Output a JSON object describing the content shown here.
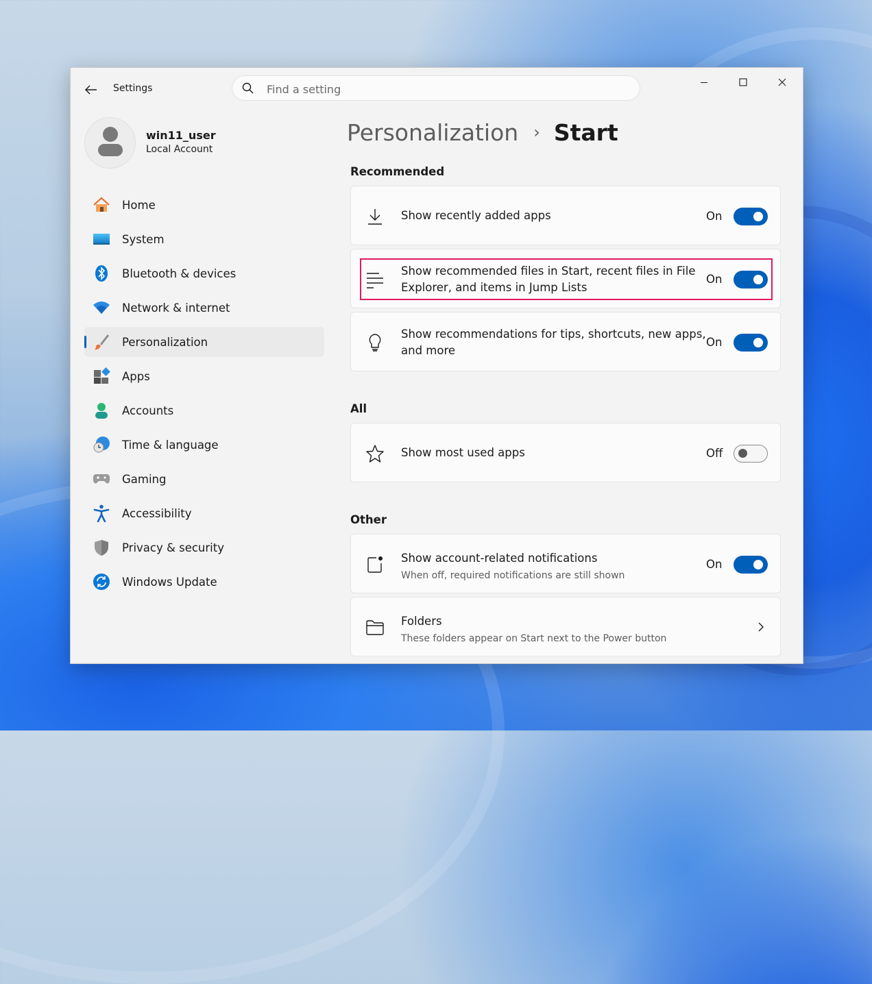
{
  "app": {
    "title": "Settings"
  },
  "search": {
    "placeholder": "Find a setting"
  },
  "user": {
    "name": "win11_user",
    "account_type": "Local Account"
  },
  "nav": [
    {
      "label": "Home",
      "icon": "home-icon"
    },
    {
      "label": "System",
      "icon": "system-icon"
    },
    {
      "label": "Bluetooth & devices",
      "icon": "bluetooth-icon"
    },
    {
      "label": "Network & internet",
      "icon": "wifi-icon"
    },
    {
      "label": "Personalization",
      "icon": "paintbrush-icon",
      "selected": true
    },
    {
      "label": "Apps",
      "icon": "apps-icon"
    },
    {
      "label": "Accounts",
      "icon": "accounts-icon"
    },
    {
      "label": "Time & language",
      "icon": "globe-clock-icon"
    },
    {
      "label": "Gaming",
      "icon": "gamepad-icon"
    },
    {
      "label": "Accessibility",
      "icon": "accessibility-icon"
    },
    {
      "label": "Privacy & security",
      "icon": "shield-icon"
    },
    {
      "label": "Windows Update",
      "icon": "update-icon"
    }
  ],
  "breadcrumb": {
    "parent": "Personalization",
    "separator": "›",
    "current": "Start"
  },
  "sections": {
    "recommended": "Recommended",
    "all": "All",
    "other": "Other"
  },
  "settings": {
    "recent_apps": {
      "label": "Show recently added apps",
      "state": "On",
      "icon": "download-icon"
    },
    "recommended_files": {
      "label_line1": "Show recommended files in Start, recent files in File",
      "label_line2": "Explorer, and items in Jump Lists",
      "state": "On",
      "icon": "list-lines-icon"
    },
    "tips": {
      "label_line1": "Show recommendations for tips, shortcuts, new apps,",
      "label_line2": "and more",
      "state": "On",
      "icon": "lightbulb-icon"
    },
    "most_used": {
      "label": "Show most used apps",
      "state": "Off",
      "icon": "star-icon"
    },
    "account_notifications": {
      "label": "Show account-related notifications",
      "sublabel": "When off, required notifications are still shown",
      "state": "On",
      "icon": "notification-icon"
    },
    "folders": {
      "label": "Folders",
      "sublabel": "These folders appear on Start next to the Power button",
      "icon": "folder-icon"
    }
  },
  "colors": {
    "accent": "#005fb8",
    "highlight": "#e0195f"
  }
}
